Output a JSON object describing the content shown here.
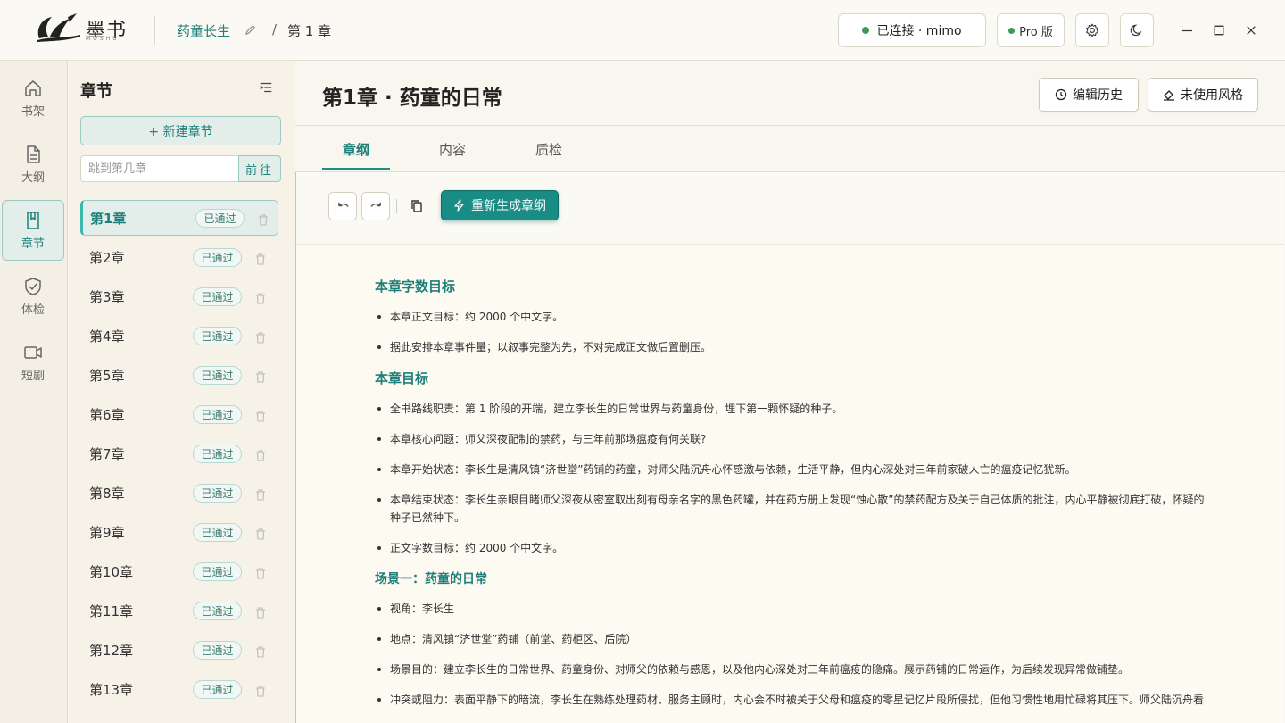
{
  "app": {
    "logo_text": "墨书",
    "logo_sub": "MOSHU"
  },
  "header": {
    "book_title": "药童长生",
    "crumb_sep": "/",
    "crumb_chapter": "第 1 章",
    "connection": "已连接 · mimo",
    "pro": "Pro 版",
    "connection_color": "#3a9a5a"
  },
  "rail": [
    {
      "label": "书架",
      "icon": "home-icon"
    },
    {
      "label": "大纲",
      "icon": "document-icon"
    },
    {
      "label": "章节",
      "icon": "book-icon"
    },
    {
      "label": "体检",
      "icon": "shield-check-icon"
    },
    {
      "label": "短剧",
      "icon": "video-icon"
    }
  ],
  "sidebar": {
    "title": "章节",
    "new_chapter": "+ 新建章节",
    "jump_placeholder": "跳到第几章",
    "jump_button": "前往",
    "chapters": [
      {
        "name": "第1章",
        "status": "已通过"
      },
      {
        "name": "第2章",
        "status": "已通过"
      },
      {
        "name": "第3章",
        "status": "已通过"
      },
      {
        "name": "第4章",
        "status": "已通过"
      },
      {
        "name": "第5章",
        "status": "已通过"
      },
      {
        "name": "第6章",
        "status": "已通过"
      },
      {
        "name": "第7章",
        "status": "已通过"
      },
      {
        "name": "第8章",
        "status": "已通过"
      },
      {
        "name": "第9章",
        "status": "已通过"
      },
      {
        "name": "第10章",
        "status": "已通过"
      },
      {
        "name": "第11章",
        "status": "已通过"
      },
      {
        "name": "第12章",
        "status": "已通过"
      },
      {
        "name": "第13章",
        "status": "已通过"
      }
    ]
  },
  "main": {
    "title": "第1章 · 药童的日常",
    "history_button": "编辑历史",
    "style_button": "未使用风格",
    "tabs": [
      {
        "label": "章纲"
      },
      {
        "label": "内容"
      },
      {
        "label": "质检"
      }
    ],
    "regen_button": "重新生成章纲",
    "accent": "#1a8c86"
  },
  "doc": {
    "s1_title": "本章字数目标",
    "s1_items": [
      "本章正文目标：约 2000 个中文字。",
      "据此安排本章事件量；以叙事完整为先，不对完成正文做后置删压。"
    ],
    "s2_title": "本章目标",
    "s2_items": [
      "全书路线职责：第 1 阶段的开端，建立李长生的日常世界与药童身份，埋下第一颗怀疑的种子。",
      "本章核心问题：师父深夜配制的禁药，与三年前那场瘟疫有何关联?",
      "本章开始状态：李长生是清风镇“济世堂”药铺的药童，对师父陆沉舟心怀感激与依赖，生活平静，但内心深处对三年前家破人亡的瘟疫记忆犹新。",
      "本章结束状态：李长生亲眼目睹师父深夜从密室取出刻有母亲名字的黑色药罐，并在药方册上发现“蚀心散”的禁药配方及关于自己体质的批注，内心平静被彻底打破，怀疑的种子已然种下。",
      "正文字数目标：约 2000 个中文字。"
    ],
    "s3_title": "场景一：药童的日常",
    "s3_items": [
      "视角：李长生",
      "地点：清风镇“济世堂”药铺（前堂、药柜区、后院）",
      "场景目的：建立李长生的日常世界、药童身份、对师父的依赖与感恩，以及他内心深处对三年前瘟疫的隐痛。展示药铺的日常运作，为后续发现异常做铺垫。",
      "冲突或阻力：表面平静下的暗流，李长生在熟练处理药材、服务主顾时，内心会不时被关于父母和瘟疫的零星记忆片段所侵扰，但他习惯性地用忙碌将其压下。师父陆沉舟看"
    ]
  }
}
